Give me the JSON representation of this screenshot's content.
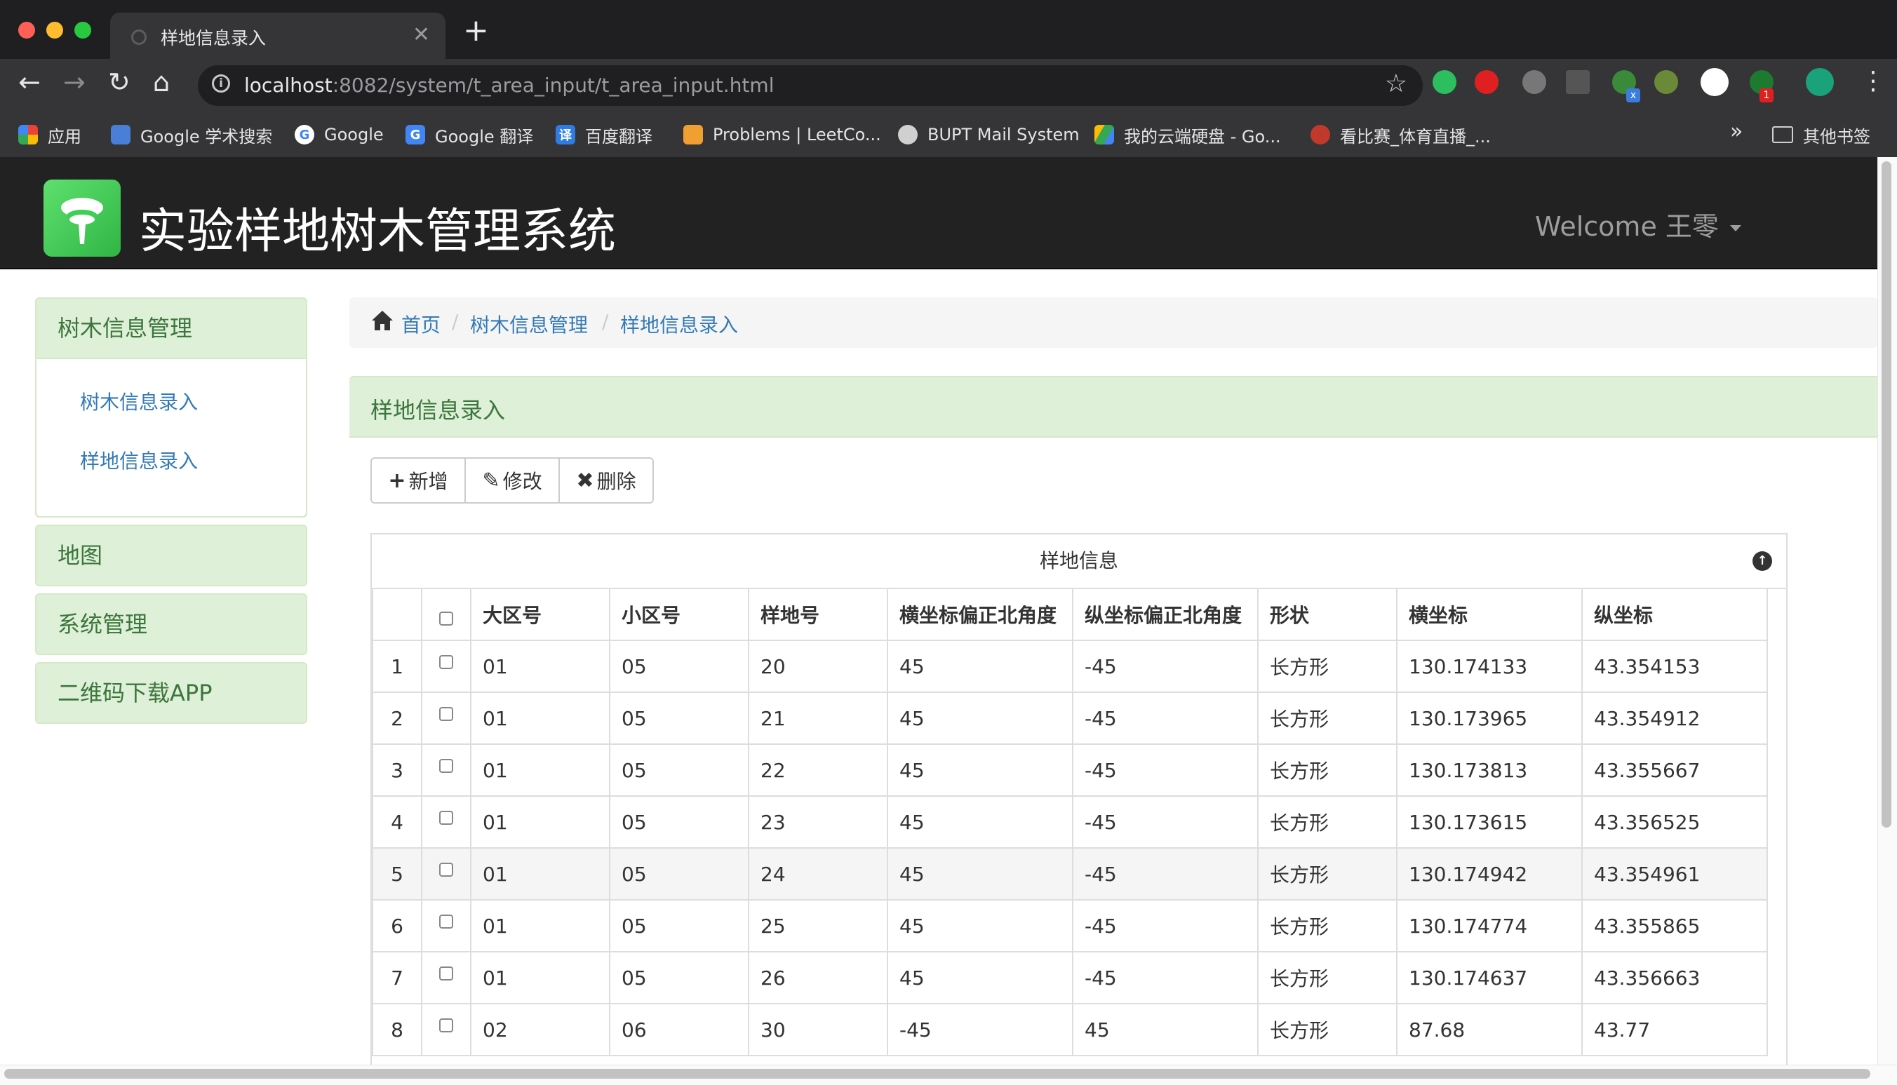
{
  "browser": {
    "tab_title": "样地信息录入",
    "url_host": "localhost",
    "url_rest": ":8082/system/t_area_input/t_area_input.html",
    "bookmarks": [
      {
        "label": "应用",
        "icon": "apps-grid-icon"
      },
      {
        "label": "Google 学术搜索",
        "icon": "google-scholar-icon"
      },
      {
        "label": "Google",
        "icon": "google-icon"
      },
      {
        "label": "Google 翻译",
        "icon": "google-translate-icon"
      },
      {
        "label": "百度翻译",
        "icon": "baidu-translate-icon"
      },
      {
        "label": "Problems | LeetCo...",
        "icon": "leetcode-icon"
      },
      {
        "label": "BUPT Mail System",
        "icon": "globe-icon"
      },
      {
        "label": "我的云端硬盘 - Go...",
        "icon": "google-drive-icon"
      },
      {
        "label": "看比赛_体育直播_...",
        "icon": "sports-live-icon"
      }
    ],
    "bookmarks_more": "»",
    "other_bookmarks": "其他书签"
  },
  "app": {
    "brand": "实验样地树木管理系统",
    "welcome": "Welcome 王零"
  },
  "sidebar": {
    "groups": [
      {
        "label": "树木信息管理",
        "items": [
          "树木信息录入",
          "样地信息录入"
        ]
      },
      {
        "label": "地图"
      },
      {
        "label": "系统管理"
      },
      {
        "label": "二维码下载APP"
      }
    ]
  },
  "breadcrumb": [
    "首页",
    "树木信息管理",
    "样地信息录入"
  ],
  "breadcrumb_sep": "/",
  "panel": {
    "title": "样地信息录入"
  },
  "toolbar": {
    "add": "新增",
    "edit": "修改",
    "delete": "删除"
  },
  "grid": {
    "caption": "样地信息",
    "columns": [
      "大区号",
      "小区号",
      "样地号",
      "横坐标偏正北角度",
      "纵坐标偏正北角度",
      "形状",
      "横坐标",
      "纵坐标"
    ],
    "rows": [
      {
        "no": "1",
        "cells": [
          "01",
          "05",
          "20",
          "45",
          "-45",
          "长方形",
          "130.174133",
          "43.354153"
        ]
      },
      {
        "no": "2",
        "cells": [
          "01",
          "05",
          "21",
          "45",
          "-45",
          "长方形",
          "130.173965",
          "43.354912"
        ]
      },
      {
        "no": "3",
        "cells": [
          "01",
          "05",
          "22",
          "45",
          "-45",
          "长方形",
          "130.173813",
          "43.355667"
        ]
      },
      {
        "no": "4",
        "cells": [
          "01",
          "05",
          "23",
          "45",
          "-45",
          "长方形",
          "130.173615",
          "43.356525"
        ]
      },
      {
        "no": "5",
        "cells": [
          "01",
          "05",
          "24",
          "45",
          "-45",
          "长方形",
          "130.174942",
          "43.354961"
        ]
      },
      {
        "no": "6",
        "cells": [
          "01",
          "05",
          "25",
          "45",
          "-45",
          "长方形",
          "130.174774",
          "43.355865"
        ]
      },
      {
        "no": "7",
        "cells": [
          "01",
          "05",
          "26",
          "45",
          "-45",
          "长方形",
          "130.174637",
          "43.356663"
        ]
      },
      {
        "no": "8",
        "cells": [
          "02",
          "06",
          "30",
          "-45",
          "45",
          "长方形",
          "87.68",
          "43.77"
        ]
      }
    ]
  },
  "colors": {
    "accent": "#337ab7",
    "panel_green": "#dff0d8",
    "panel_text": "#3c763d",
    "navbar": "#222222"
  }
}
